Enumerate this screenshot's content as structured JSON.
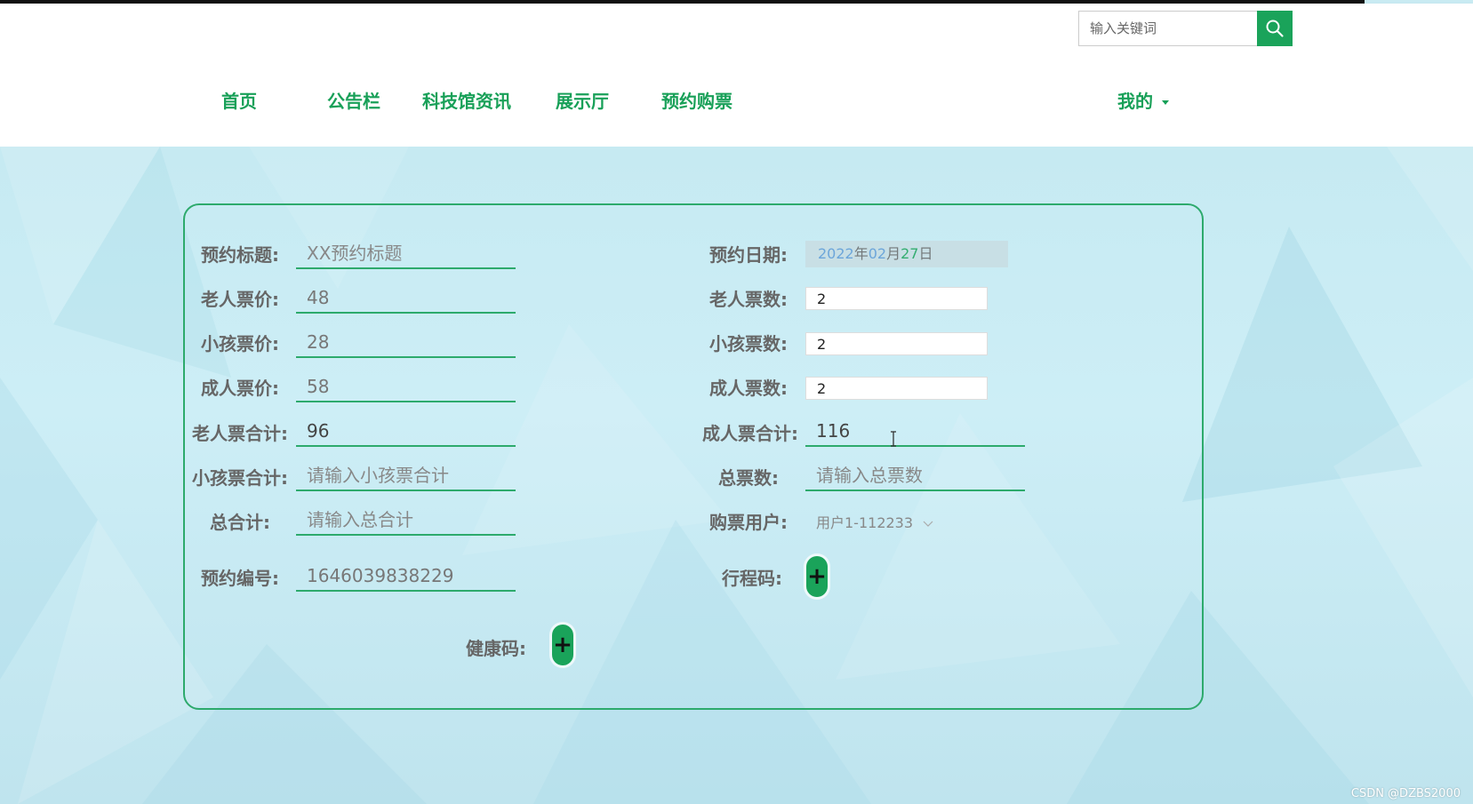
{
  "search": {
    "placeholder": "输入关键词"
  },
  "nav": {
    "home": "首页",
    "bulletin": "公告栏",
    "news": "科技馆资讯",
    "hall": "展示厅",
    "booking": "预约购票",
    "mine": "我的"
  },
  "form": {
    "title_label": "预约标题:",
    "title_placeholder": "XX预约标题",
    "date_label": "预约日期:",
    "date": {
      "year": "2022",
      "year_unit": "年",
      "month": "02",
      "month_unit": "月",
      "day": "27",
      "day_unit": "日"
    },
    "elder_price_label": "老人票价:",
    "elder_price": "48",
    "elder_count_label": "老人票数:",
    "elder_count": "2",
    "child_price_label": "小孩票价:",
    "child_price": "28",
    "child_count_label": "小孩票数:",
    "child_count": "2",
    "adult_price_label": "成人票价:",
    "adult_price": "58",
    "adult_count_label": "成人票数:",
    "adult_count": "2",
    "elder_total_label": "老人票合计:",
    "elder_total": "96",
    "adult_total_label": "成人票合计:",
    "adult_total": "116",
    "child_total_label": "小孩票合计:",
    "child_total_placeholder": "请输入小孩票合计",
    "ticket_total_label": "总票数:",
    "ticket_total_placeholder": "请输入总票数",
    "grand_total_label": "总合计:",
    "grand_total_placeholder": "请输入总合计",
    "user_label": "购票用户:",
    "user_value": "用户1-112233",
    "booking_no_label": "预约编号:",
    "booking_no": "1646039838229",
    "trip_code_label": "行程码:",
    "health_code_label": "健康码:",
    "plus_symbol": "+"
  },
  "watermark": "CSDN @DZBS2000",
  "colors": {
    "accent": "#1aa35a",
    "nav_text": "#18a058",
    "background": "#c9ebf2"
  }
}
